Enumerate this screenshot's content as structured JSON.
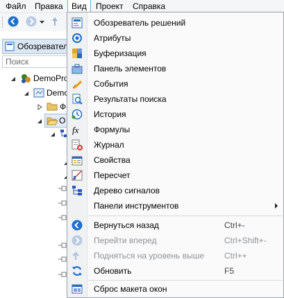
{
  "menubar": {
    "items": [
      "Файл",
      "Правка",
      "Вид",
      "Проект",
      "Справка"
    ]
  },
  "left_panel": {
    "tab_label": "Обозреватель решений",
    "search_placeholder": "Поиск",
    "tree": [
      "DemoProject",
      "DemoProject",
      "Ф",
      "О"
    ]
  },
  "view_menu": {
    "items": [
      {
        "label": "Обозреватель решений",
        "icon": "solution-explorer-icon"
      },
      {
        "label": "Атрибуты",
        "icon": "attributes-icon"
      },
      {
        "label": "Буферизация",
        "icon": "buffering-icon"
      },
      {
        "label": "Панель элементов",
        "icon": "toolbox-icon"
      },
      {
        "label": "События",
        "icon": "events-icon"
      },
      {
        "label": "Результаты поиска",
        "icon": "search-results-icon"
      },
      {
        "label": "История",
        "icon": "history-icon"
      },
      {
        "label": "Формулы",
        "icon": "formula-icon"
      },
      {
        "label": "Журнал",
        "icon": "journal-icon"
      },
      {
        "label": "Свойства",
        "icon": "properties-icon"
      },
      {
        "label": "Пересчет",
        "icon": "recalc-icon"
      },
      {
        "label": "Дерево сигналов",
        "icon": "signal-tree-icon"
      },
      {
        "label": "Панели инструментов",
        "icon": "",
        "submenu": true
      }
    ],
    "nav_items": [
      {
        "label": "Вернуться назад",
        "shortcut": "Ctrl+-",
        "icon": "back-icon",
        "enabled": true
      },
      {
        "label": "Перейти вперед",
        "shortcut": "Ctrl+Shift+-",
        "icon": "forward-icon",
        "enabled": false
      },
      {
        "label": "Подняться на уровень выше",
        "shortcut": "Ctrl++",
        "icon": "up-level-icon",
        "enabled": false
      },
      {
        "label": "Обновить",
        "shortcut": "F5",
        "icon": "refresh-icon",
        "enabled": true
      }
    ],
    "reset_item": {
      "label": "Сброс макета окон",
      "icon": "reset-layout-icon"
    }
  },
  "colors": {
    "accent": "#1e6fcc",
    "menu_bg": "#fafafa",
    "gutter": "#f0f1f3"
  }
}
